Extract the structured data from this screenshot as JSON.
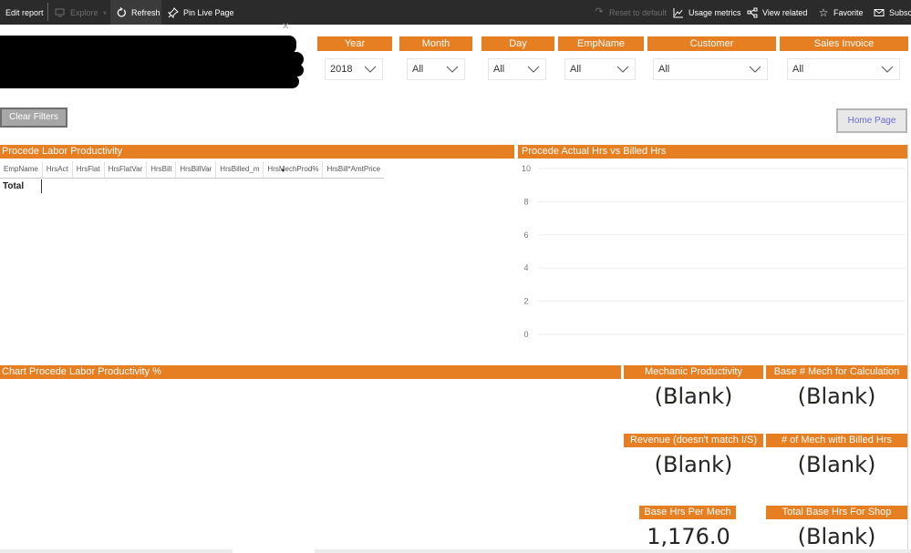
{
  "toolbar": {
    "edit_report": "Edit report",
    "explore": "Explore",
    "refresh": "Refresh",
    "pin_live_page": "Pin Live Page",
    "reset_to_default": "Reset to default",
    "usage_metrics": "Usage metrics",
    "view_related": "View related",
    "favorite": "Favorite",
    "subscribe": "Subscribe"
  },
  "slicers": [
    {
      "label": "Year",
      "value": "2018"
    },
    {
      "label": "Month",
      "value": "All"
    },
    {
      "label": "Day",
      "value": "All"
    },
    {
      "label": "EmpName",
      "value": "All"
    },
    {
      "label": "Customer",
      "value": "All"
    },
    {
      "label": "Sales Invoice",
      "value": "All"
    }
  ],
  "buttons": {
    "clear_filters": "Clear Filters",
    "home_page": "Home Page"
  },
  "labor_table": {
    "title": "Procede Labor Productivity",
    "columns": [
      "EmpName",
      "HrsAct",
      "HrsFlat",
      "HrsFlatVar",
      "HrsBill",
      "HrsBillVar",
      "HrsBilled_m",
      "HrsMechProd%",
      "HrsBill*AmtPrice"
    ],
    "sorted_column": "HrsMechProd%",
    "total_label": "Total"
  },
  "chart_data": {
    "type": "bar",
    "title": "Procede Actual Hrs vs Billed Hrs",
    "categories": [],
    "series": [],
    "xlabel": "",
    "ylabel": "",
    "ylim": [
      0,
      10
    ],
    "yticks": [
      10,
      8,
      6,
      4,
      2,
      0
    ],
    "grid": true
  },
  "productivity_chart": {
    "title": "Chart Procede Labor Productivity %"
  },
  "cards": [
    {
      "label": "Mechanic Productivity",
      "value": "(Blank)"
    },
    {
      "label": "Base # Mech for Calculation",
      "value": "(Blank)"
    },
    {
      "label": "Revenue (doesn't match I/S)",
      "value": "(Blank)"
    },
    {
      "label": "# of Mech with Billed Hrs",
      "value": "(Blank)"
    },
    {
      "label": "Base Hrs Per Mech",
      "value": "1,176.0"
    },
    {
      "label": "Total Base Hrs For Shop",
      "value": "(Blank)"
    }
  ],
  "colors": {
    "accent": "#e67e22",
    "toolbar_bg": "#2b2b2b",
    "home_link": "#6b6bd6"
  }
}
